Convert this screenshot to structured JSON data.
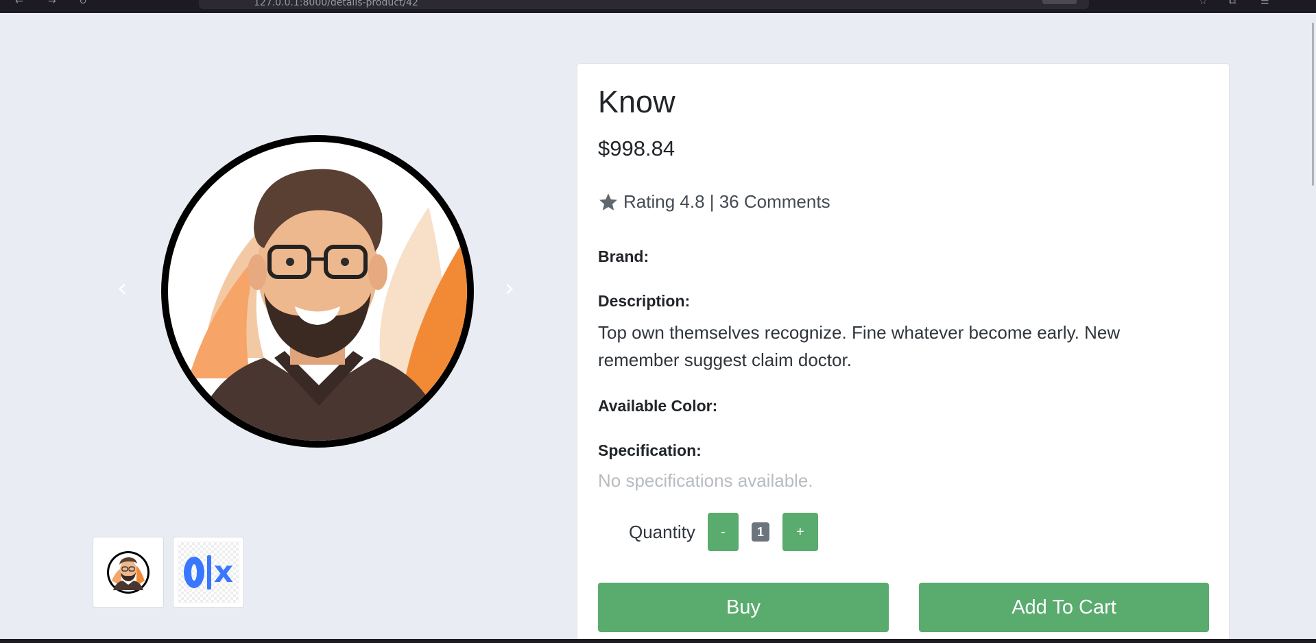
{
  "browser": {
    "url": "127.0.0.1:8000/details-product/42"
  },
  "gallery": {
    "main_image_alt": "cartoon man avatar",
    "prev_icon": "chevron-left-icon",
    "next_icon": "chevron-right-icon",
    "prev_glyph": "‹",
    "next_glyph": "›",
    "thumbnails": [
      {
        "name": "avatar-thumbnail"
      },
      {
        "name": "olx-logo-thumbnail"
      }
    ]
  },
  "product": {
    "title": "Know",
    "price": "$998.84",
    "rating_text": "Rating 4.8 | 36 Comments",
    "rating_icon": "star-icon",
    "brand_label": "Brand:",
    "description_label": "Description:",
    "description": "Top own themselves recognize. Fine whatever become early. New remember suggest claim doctor.",
    "color_label": "Available Color:",
    "specification_label": "Specification:",
    "specification_empty": "No specifications available."
  },
  "quantity": {
    "label": "Quantity",
    "minus": "-",
    "value": "1",
    "plus": "+"
  },
  "actions": {
    "buy": "Buy",
    "add_to_cart": "Add To Cart"
  },
  "colors": {
    "accent_green": "#59ab6e",
    "background": "#e9edf3",
    "badge_gray": "#6c757d"
  }
}
